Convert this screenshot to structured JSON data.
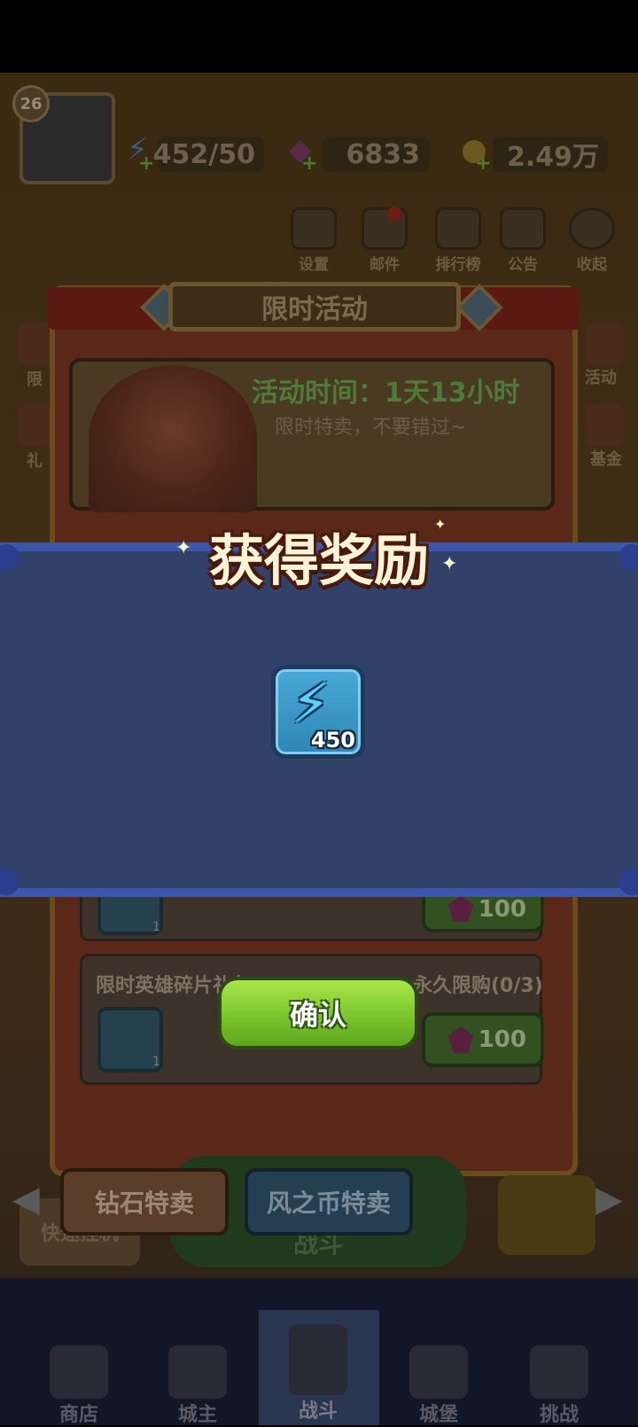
{
  "hud": {
    "level": "26",
    "energy": "452/50",
    "gems": "6833",
    "coins": "2.49万"
  },
  "top_buttons": [
    "设置",
    "邮件",
    "排行榜",
    "公告",
    "收起"
  ],
  "event_panel": {
    "title": "限时活动",
    "time": "活动时间：1天13小时",
    "subtitle": "限时特卖，不要错过~",
    "offer_title": "限时英雄碎片礼包",
    "offer_limit": "永久限购(0/3)",
    "item_count_1": "1",
    "item_count_2": "1",
    "price_1": "100",
    "price_2": "100"
  },
  "side_labels": {
    "left_1": "限",
    "left_2": "礼",
    "right_1": "活动",
    "right_2": "基金"
  },
  "reward": {
    "title": "获得奖励",
    "item_icon": "energy-bolt-icon",
    "quantity": "450",
    "confirm": "确认"
  },
  "shop_tabs": {
    "diamond": "钻石特卖",
    "wind": "风之币特卖",
    "quick": "快速挂机",
    "battle": "战斗"
  },
  "bottom_nav": [
    "商店",
    "城主",
    "战斗",
    "城堡",
    "挑战"
  ],
  "colors": {
    "reward_strip": "#314169",
    "reward_border": "#3e56a8",
    "confirm_green": "#7cc52e"
  }
}
